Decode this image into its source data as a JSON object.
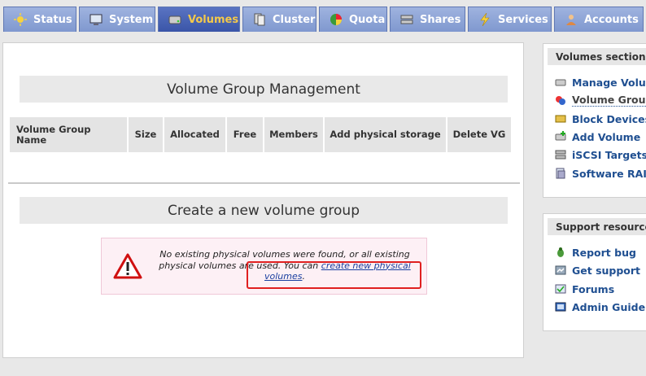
{
  "tabs": [
    {
      "label": "Status",
      "icon": "status-icon"
    },
    {
      "label": "System",
      "icon": "system-icon"
    },
    {
      "label": "Volumes",
      "icon": "volumes-icon",
      "active": true
    },
    {
      "label": "Cluster",
      "icon": "cluster-icon"
    },
    {
      "label": "Quota",
      "icon": "quota-icon"
    },
    {
      "label": "Shares",
      "icon": "shares-icon"
    },
    {
      "label": "Services",
      "icon": "services-icon"
    },
    {
      "label": "Accounts",
      "icon": "accounts-icon"
    }
  ],
  "main": {
    "vg_title": "Volume Group Management",
    "columns": [
      "Volume Group Name",
      "Size",
      "Allocated",
      "Free",
      "Members",
      "Add physical storage",
      "Delete VG"
    ],
    "create_title": "Create a new volume group",
    "warning": {
      "text": "No existing physical volumes were found, or all existing physical volumes are used. You can",
      "link": "create new physical volumes",
      "tail": "."
    }
  },
  "sidebar": {
    "volumes_section": {
      "title": "Volumes section",
      "items": [
        {
          "label": "Manage Volumes",
          "icon": "disk-icon"
        },
        {
          "label": "Volume Groups",
          "icon": "volume-group-icon",
          "current": true
        },
        {
          "label": "Block Devices",
          "icon": "block-device-icon"
        },
        {
          "label": "Add Volume",
          "icon": "add-volume-icon"
        },
        {
          "label": "iSCSI Targets",
          "icon": "iscsi-icon"
        },
        {
          "label": "Software RAID",
          "icon": "raid-icon"
        }
      ]
    },
    "support": {
      "title": "Support resources",
      "items": [
        {
          "label": "Report bug",
          "icon": "bug-icon"
        },
        {
          "label": "Get support",
          "icon": "support-icon"
        },
        {
          "label": "Forums",
          "icon": "forums-icon"
        },
        {
          "label": "Admin Guide",
          "icon": "guide-icon"
        }
      ]
    }
  },
  "colors": {
    "tab_bg": "#8ea4d8",
    "tab_active_bg": "#4a64b6",
    "tab_active_text": "#f4c94a",
    "link": "#1f4f91",
    "warn_border": "#e02020"
  }
}
